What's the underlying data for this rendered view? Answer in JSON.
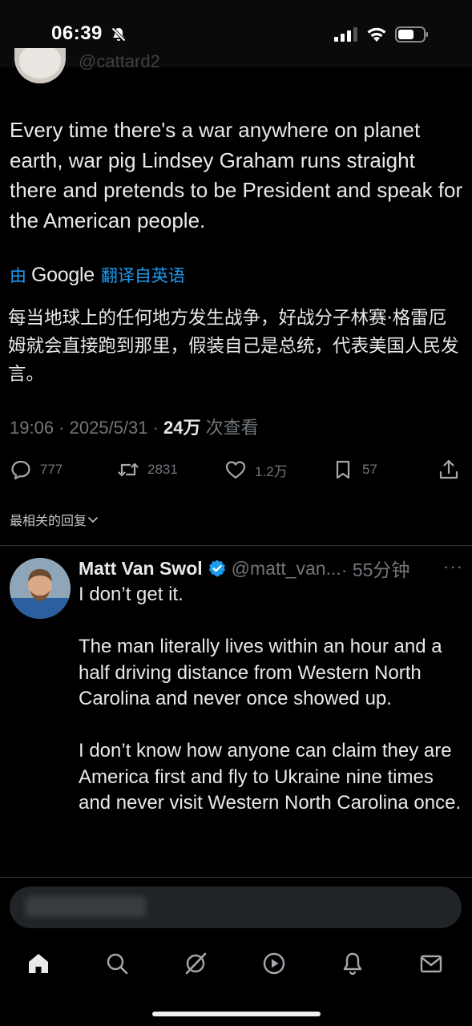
{
  "status_bar": {
    "time": "06:39"
  },
  "tweet": {
    "handle_partial": "@cattard2",
    "text": "Every time there's a war anywhere on planet earth, war pig Lindsey Graham runs straight there and pretends to be President and speak for the American people.",
    "translate_prefix": "由",
    "translate_brand": "Google",
    "translate_suffix": "翻译自英语",
    "translated_text": "每当地球上的任何地方发生战争，好战分子林赛·格雷厄姆就会直接跑到那里，假装自己是总统，代表美国人民发言。",
    "timestamp": "19:06 · 2025/5/31 · ",
    "views_count": "24万",
    "views_label": " 次查看",
    "actions": {
      "replies": "777",
      "retweets": "2831",
      "likes": "1.2万",
      "bookmarks": "57"
    }
  },
  "sort_label": "最相关的回复",
  "reply": {
    "name": "Matt Van Swol",
    "handle": "@matt_van...",
    "time": "· 55分钟",
    "more": "···",
    "paragraphs": [
      "I don’t get it.",
      "The man literally lives within an hour and a half driving distance from Western North Carolina and never once showed up.",
      "I don’t know how anyone can claim they are America first and fly to Ukraine nine times and never visit Western North Carolina once."
    ]
  },
  "icons": {
    "bell": "bell-slash-icon",
    "signal": "signal-icon",
    "wifi": "wifi-icon",
    "battery": "battery-icon",
    "reply": "reply-icon",
    "retweet": "retweet-icon",
    "like": "heart-icon",
    "bookmark": "bookmark-icon",
    "share": "share-icon",
    "nav": [
      "home-icon",
      "search-icon",
      "grok-icon",
      "video-icon",
      "notifications-icon",
      "messages-icon"
    ]
  },
  "colors": {
    "accent": "#1d9bf0",
    "muted": "#71767b",
    "text": "#e7e9ea",
    "background": "#000000"
  }
}
